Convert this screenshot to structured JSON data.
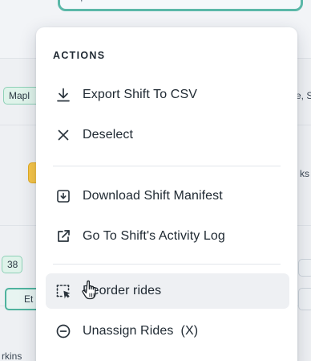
{
  "background": {
    "chips": {
      "top_left": "Mapl",
      "top_right": "e, S",
      "mid_right": "ks",
      "left_small": "38",
      "left_name": "Et",
      "bottom_left": "rkins"
    }
  },
  "menu": {
    "title": "ACTIONS",
    "items": [
      {
        "label": "Export Shift To CSV",
        "icon": "download-icon"
      },
      {
        "label": "Deselect",
        "icon": "close-icon"
      },
      {
        "label": "Download Shift Manifest",
        "icon": "file-download-icon"
      },
      {
        "label": "Go To Shift's Activity Log",
        "icon": "external-link-icon"
      },
      {
        "label": "Reorder rides",
        "icon": "select-reorder-icon",
        "hovered": true
      },
      {
        "label": "Unassign Rides  (X)",
        "icon": "minus-circle-icon"
      }
    ]
  },
  "colors": {
    "accent_teal": "#4fb39e",
    "accent_yellow": "#f7c547",
    "menu_text": "#202a33"
  }
}
